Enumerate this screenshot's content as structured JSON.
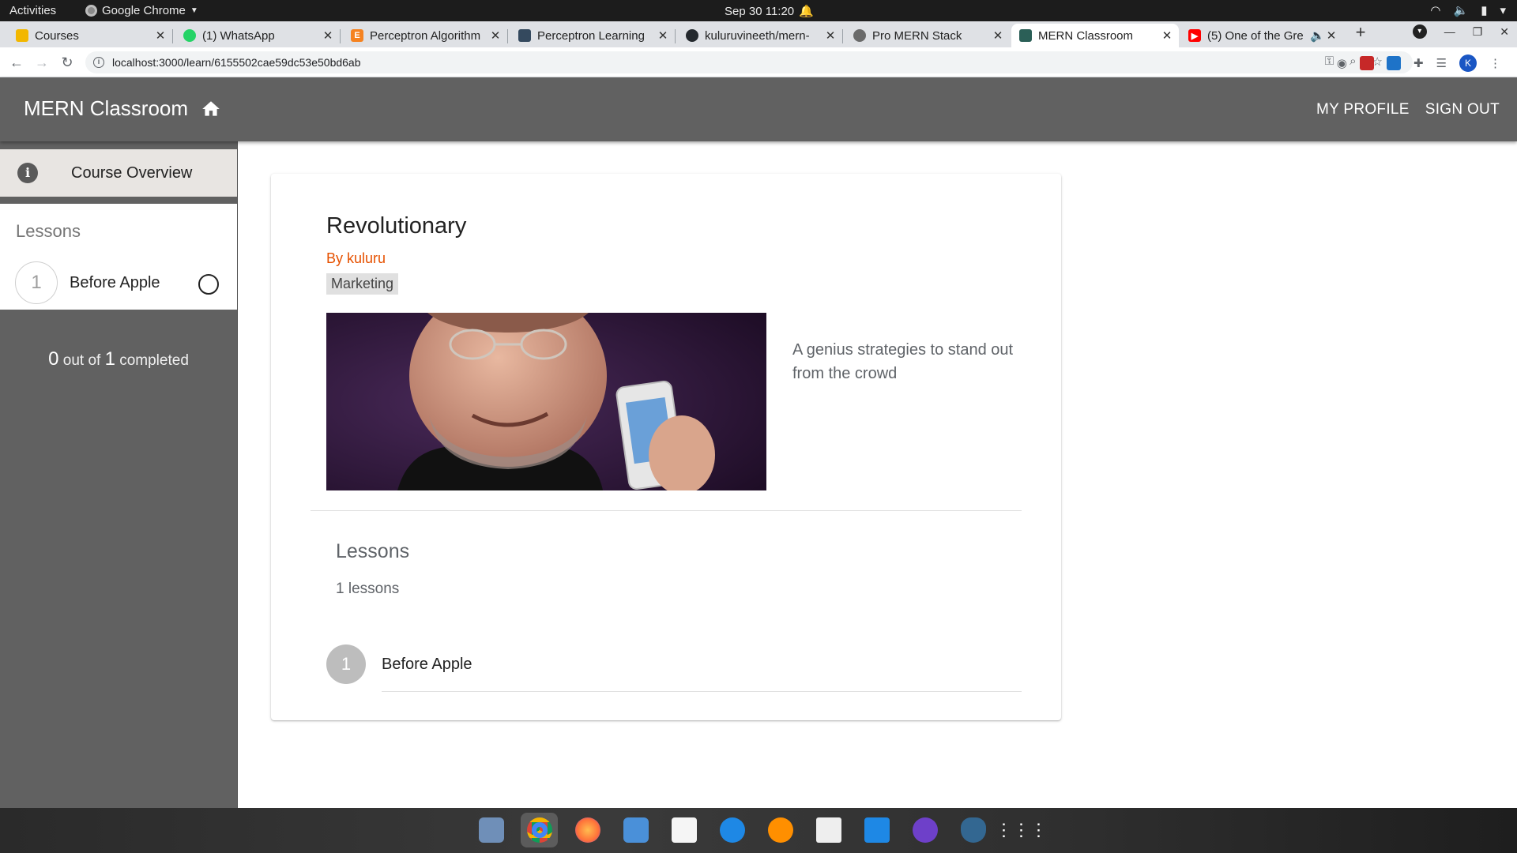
{
  "system_bar": {
    "activities": "Activities",
    "app_name": "Google Chrome",
    "clock": "Sep 30  11:20"
  },
  "browser": {
    "tabs": [
      {
        "title": "Courses",
        "favicon_color": "#f2b700"
      },
      {
        "title": "(1) WhatsApp",
        "favicon_color": "#25d366"
      },
      {
        "title": "Perceptron Algorithm",
        "favicon_color": "#f58220"
      },
      {
        "title": "Perceptron Learning",
        "favicon_color": "#34495e"
      },
      {
        "title": "kuluruvineeth/mern-",
        "favicon_color": "#24292e"
      },
      {
        "title": "Pro MERN Stack",
        "favicon_color": "#6a6a6a"
      },
      {
        "title": "MERN Classroom",
        "favicon_color": "#2b5f57"
      },
      {
        "title": "(5) One of the Gre",
        "favicon_color": "#ff0000"
      }
    ],
    "url": "localhost:3000/learn/6155502cae59dc53e50bd6ab",
    "profile_initial": "K"
  },
  "appbar": {
    "title": "MERN Classroom",
    "nav": {
      "profile": "MY PROFILE",
      "signout": "SIGN OUT"
    }
  },
  "drawer": {
    "overview_label": "Course Overview",
    "lessons_heading": "Lessons",
    "lessons": [
      {
        "number": "1",
        "title": "Before Apple"
      }
    ],
    "progress": {
      "completed": "0",
      "out_of": "out of",
      "total": "1",
      "suffix": "completed"
    }
  },
  "course": {
    "title": "Revolutionary",
    "author": "By kuluru",
    "category": "Marketing",
    "description": "A genius strategies to stand out from the crowd",
    "lessons_title": "Lessons",
    "lessons_count": "1 lessons",
    "lessons": [
      {
        "number": "1",
        "title": "Before Apple"
      }
    ]
  },
  "colors": {
    "appbar": "#616161",
    "author": "#e65100",
    "drawer_active": "#e8e5e2"
  }
}
